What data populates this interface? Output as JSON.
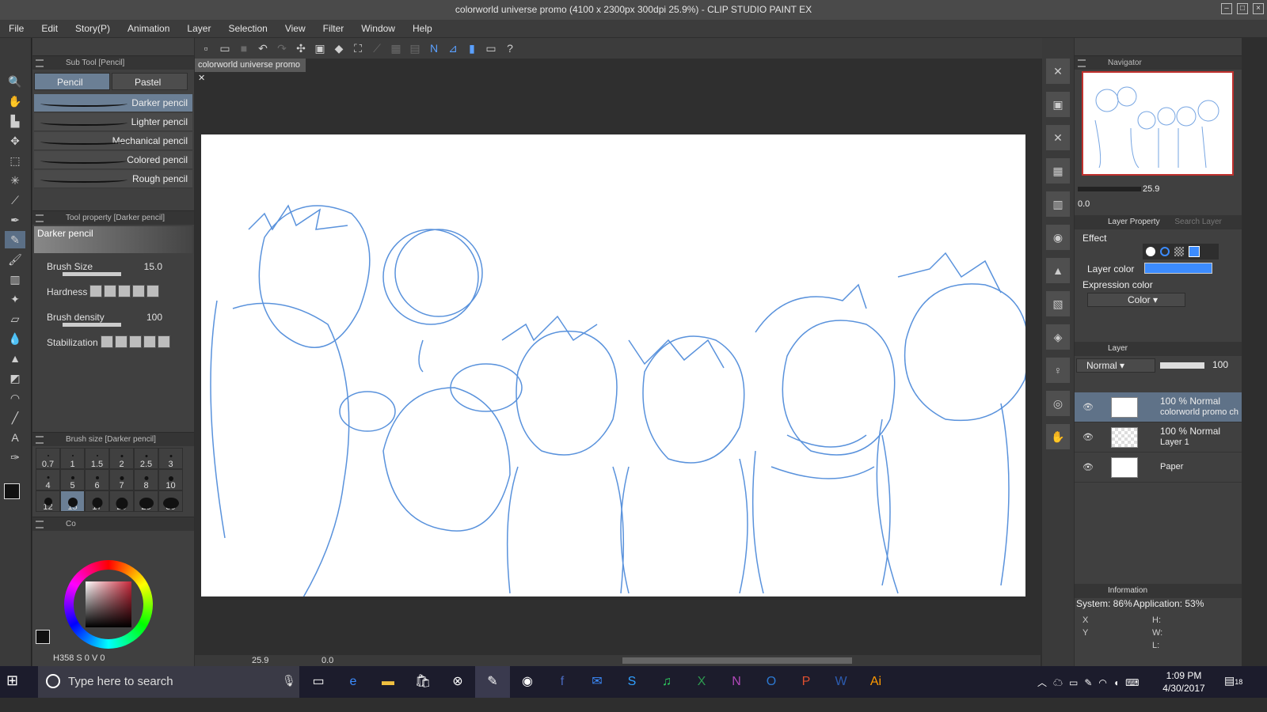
{
  "window": {
    "title": "colorworld universe promo (4100 x 2300px 300dpi 25.9%)  - CLIP STUDIO PAINT EX"
  },
  "menu": [
    "File",
    "Edit",
    "Story(P)",
    "Animation",
    "Layer",
    "Selection",
    "View",
    "Filter",
    "Window",
    "Help"
  ],
  "subtool": {
    "header": "Sub Tool [Pencil]",
    "tabs": [
      "Pencil",
      "Pastel"
    ],
    "brushes": [
      "Darker pencil",
      "Lighter pencil",
      "Mechanical pencil",
      "Colored pencil",
      "Rough pencil"
    ]
  },
  "toolprop": {
    "header": "Tool property [Darker pencil]",
    "preview_label": "Darker pencil",
    "brush_size_label": "Brush Size",
    "brush_size": "15.0",
    "hardness_label": "Hardness",
    "density_label": "Brush density",
    "density": "100",
    "stabilization_label": "Stabilization"
  },
  "brushsize": {
    "header": "Brush size [Darker pencil]",
    "sizes": [
      "0.7",
      "1",
      "1.5",
      "2",
      "2.5",
      "3",
      "4",
      "5",
      "6",
      "7",
      "8",
      "10",
      "12",
      "15",
      "17",
      "20",
      "25",
      "30"
    ],
    "selected": "15"
  },
  "color": {
    "tab": "Co",
    "h": "358",
    "s": "0",
    "v": "0",
    "h_label": "H",
    "s_label": "S",
    "v_label": "V"
  },
  "document": {
    "tab": "colorworld universe promo",
    "zoom": "25.9",
    "angle": "0.0"
  },
  "navigator": {
    "header": "Navigator",
    "zoom": "25.9",
    "angle": "0.0"
  },
  "layerprop": {
    "header": "Layer Property",
    "search": "Search Layer",
    "effect": "Effect",
    "layer_color": "Layer color",
    "expression_color": "Expression color",
    "expression_value": "Color"
  },
  "layers": {
    "header": "Layer",
    "blend": "Normal",
    "opacity": "100",
    "rows": [
      {
        "pct": "100 %",
        "mode": "Normal",
        "name": "colorworld promo ch"
      },
      {
        "pct": "100 %",
        "mode": "Normal",
        "name": "Layer 1"
      },
      {
        "pct": "",
        "mode": "",
        "name": "Paper"
      }
    ]
  },
  "info": {
    "header": "Information",
    "system": "System: 86%",
    "application": "Application: 53%",
    "x": "X",
    "y": "Y",
    "h": "H:",
    "w": "W:",
    "l": "L:"
  },
  "taskbar": {
    "search": "Type here to search",
    "time": "1:09 PM",
    "date": "4/30/2017",
    "notif": "18"
  }
}
